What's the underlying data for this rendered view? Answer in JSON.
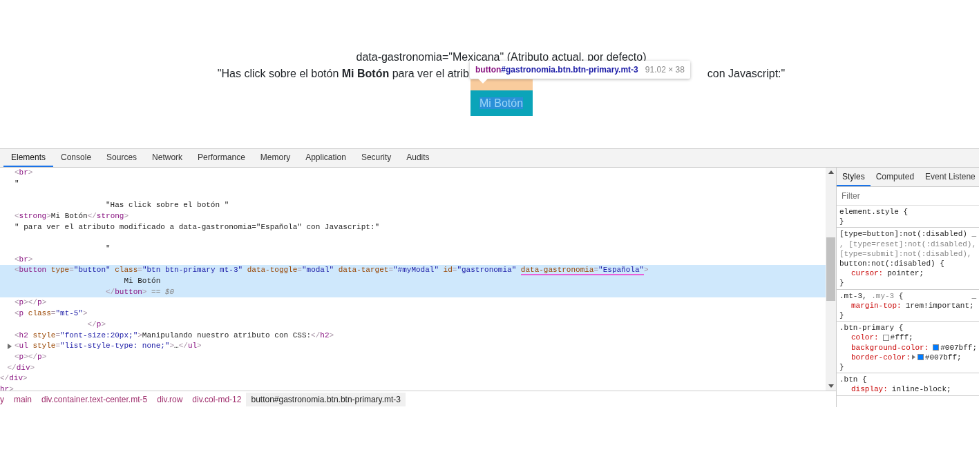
{
  "page": {
    "lines": [
      {
        "segments": [
          "data-gastronomia=\"Mexicana\" (Atributo actual, por defecto)"
        ]
      },
      {
        "segments": [
          "\"Has click sobre el botón **Mi Botón** para ver el atrib",
          "con Javascript:\""
        ]
      }
    ],
    "button": {
      "label": "Mi Botón",
      "inspected": true
    }
  },
  "tooltip": {
    "tag": "button",
    "selector": "#gastronomia.btn.btn-primary.mt-3",
    "size": "91.02 × 38"
  },
  "devtools": {
    "tabs": [
      {
        "label": "Elements",
        "selected": true
      },
      {
        "label": "Console",
        "selected": false
      },
      {
        "label": "Sources",
        "selected": false
      },
      {
        "label": "Network",
        "selected": false
      },
      {
        "label": "Performance",
        "selected": false
      },
      {
        "label": "Memory",
        "selected": false
      },
      {
        "label": "Application",
        "selected": false
      },
      {
        "label": "Security",
        "selected": false
      },
      {
        "label": "Audits",
        "selected": false
      }
    ],
    "dom_tree": [
      {
        "selected": false,
        "closing": [
          {
            "kind": "punct",
            "text": "</"
          },
          {
            "kind": "tag",
            "text": "div"
          },
          {
            "kind": "punct",
            "text": ">"
          }
        ],
        "children": [
          {
            "selected": false,
            "closing": [
              {
                "kind": "punct",
                "text": "</"
              },
              {
                "kind": "tag",
                "text": "div"
              },
              {
                "kind": "punct",
                "text": ">"
              }
            ],
            "children": [
              {
                "selected": false,
                "lines": [
                  {
                    "tokens": [
                      {
                        "kind": "punct",
                        "text": "<"
                      },
                      {
                        "kind": "tag",
                        "text": "br"
                      },
                      {
                        "kind": "punct",
                        "text": ">"
                      }
                    ]
                  }
                ]
              },
              {
                "selected": false,
                "lines": [
                  {
                    "tokens": [
                      {
                        "kind": "text",
                        "text": "\"\n\n                    \"Has click sobre el botón \""
                      }
                    ]
                  }
                ]
              },
              {
                "selected": false,
                "lines": [
                  {
                    "tokens": [
                      {
                        "kind": "punct",
                        "text": "<"
                      },
                      {
                        "kind": "tag",
                        "text": "strong"
                      },
                      {
                        "kind": "punct",
                        "text": ">"
                      },
                      {
                        "kind": "text",
                        "text": "Mi Botón"
                      },
                      {
                        "kind": "punct",
                        "text": "</"
                      },
                      {
                        "kind": "tag",
                        "text": "strong"
                      },
                      {
                        "kind": "punct",
                        "text": ">"
                      }
                    ]
                  }
                ]
              },
              {
                "selected": false,
                "lines": [
                  {
                    "tokens": [
                      {
                        "kind": "text",
                        "text": "\" para ver el atributo modificado a data-gastronomia=\"Española\" con Javascript:\"\n\n                    \""
                      }
                    ]
                  }
                ]
              },
              {
                "selected": false,
                "lines": [
                  {
                    "tokens": [
                      {
                        "kind": "punct",
                        "text": "<"
                      },
                      {
                        "kind": "tag",
                        "text": "br"
                      },
                      {
                        "kind": "punct",
                        "text": ">"
                      }
                    ]
                  }
                ]
              },
              {
                "selected": true,
                "lines": [
                  {
                    "tokens": [
                      {
                        "kind": "punct",
                        "text": "<"
                      },
                      {
                        "kind": "tag",
                        "text": "button"
                      },
                      {
                        "kind": "attr",
                        "text": " type"
                      },
                      {
                        "kind": "punct",
                        "text": "="
                      },
                      {
                        "kind": "value",
                        "text": "\"button\""
                      },
                      {
                        "kind": "attr",
                        "text": " class"
                      },
                      {
                        "kind": "punct",
                        "text": "="
                      },
                      {
                        "kind": "value",
                        "text": "\"btn btn-primary mt-3\""
                      },
                      {
                        "kind": "attr",
                        "text": " data-toggle"
                      },
                      {
                        "kind": "punct",
                        "text": "="
                      },
                      {
                        "kind": "value",
                        "text": "\"modal\""
                      },
                      {
                        "kind": "attr",
                        "text": " data-target"
                      },
                      {
                        "kind": "punct",
                        "text": "="
                      },
                      {
                        "kind": "value",
                        "text": "\"#myModal\""
                      },
                      {
                        "kind": "attr",
                        "text": " id"
                      },
                      {
                        "kind": "punct",
                        "text": "="
                      },
                      {
                        "kind": "value",
                        "text": "\"gastronomia\" "
                      },
                      {
                        "kind": "underlined",
                        "tokens": [
                          {
                            "kind": "attr",
                            "text": "data-gastronomia"
                          },
                          {
                            "kind": "punct",
                            "text": "="
                          },
                          {
                            "kind": "value",
                            "text": "\"Española\""
                          }
                        ]
                      },
                      {
                        "kind": "punct",
                        "text": ">"
                      }
                    ]
                  },
                  {
                    "tokens": [
                      {
                        "kind": "text",
                        "text": "                        Mi Botón"
                      }
                    ]
                  },
                  {
                    "tokens": [
                      {
                        "kind": "punct",
                        "text": "                    </"
                      },
                      {
                        "kind": "tag",
                        "text": "button"
                      },
                      {
                        "kind": "punct",
                        "text": ">"
                      },
                      {
                        "kind": "note",
                        "text": " == $0"
                      }
                    ]
                  }
                ]
              },
              {
                "selected": false,
                "lines": [
                  {
                    "tokens": [
                      {
                        "kind": "punct",
                        "text": "<"
                      },
                      {
                        "kind": "tag",
                        "text": "p"
                      },
                      {
                        "kind": "punct",
                        "text": ">"
                      },
                      {
                        "kind": "punct",
                        "text": "</"
                      },
                      {
                        "kind": "tag",
                        "text": "p"
                      },
                      {
                        "kind": "punct",
                        "text": ">"
                      }
                    ]
                  }
                ]
              },
              {
                "selected": false,
                "lines": [
                  {
                    "tokens": [
                      {
                        "kind": "punct",
                        "text": "<"
                      },
                      {
                        "kind": "tag",
                        "text": "p"
                      },
                      {
                        "kind": "attr",
                        "text": " class"
                      },
                      {
                        "kind": "punct",
                        "text": "="
                      },
                      {
                        "kind": "value",
                        "text": "\"mt-5\""
                      },
                      {
                        "kind": "punct",
                        "text": ">"
                      }
                    ]
                  },
                  {
                    "tokens": [
                      {
                        "kind": "punct",
                        "text": "                </"
                      },
                      {
                        "kind": "tag",
                        "text": "p"
                      },
                      {
                        "kind": "punct",
                        "text": ">"
                      }
                    ]
                  }
                ]
              },
              {
                "selected": false,
                "lines": [
                  {
                    "tokens": [
                      {
                        "kind": "punct",
                        "text": "<"
                      },
                      {
                        "kind": "tag",
                        "text": "h2"
                      },
                      {
                        "kind": "attr",
                        "text": " style"
                      },
                      {
                        "kind": "punct",
                        "text": "="
                      },
                      {
                        "kind": "value",
                        "text": "\"font-size:20px;\""
                      },
                      {
                        "kind": "punct",
                        "text": ">"
                      },
                      {
                        "kind": "text",
                        "text": "Manipulando nuestro atributo con CSS:"
                      },
                      {
                        "kind": "punct",
                        "text": "</"
                      },
                      {
                        "kind": "tag",
                        "text": "h2"
                      },
                      {
                        "kind": "punct",
                        "text": ">"
                      }
                    ]
                  }
                ]
              },
              {
                "selected": false,
                "expanded": false,
                "lines": [
                  {
                    "tokens": [
                      {
                        "kind": "punct",
                        "text": "<"
                      },
                      {
                        "kind": "tag",
                        "text": "ul"
                      },
                      {
                        "kind": "attr",
                        "text": " style"
                      },
                      {
                        "kind": "punct",
                        "text": "="
                      },
                      {
                        "kind": "value",
                        "text": "\"list-style-type: none;\""
                      },
                      {
                        "kind": "punct",
                        "text": ">"
                      },
                      {
                        "kind": "text",
                        "text": "…"
                      },
                      {
                        "kind": "punct",
                        "text": "</"
                      },
                      {
                        "kind": "tag",
                        "text": "ul"
                      },
                      {
                        "kind": "punct",
                        "text": ">"
                      }
                    ]
                  }
                ]
              },
              {
                "selected": false,
                "lines": [
                  {
                    "tokens": [
                      {
                        "kind": "punct",
                        "text": "<"
                      },
                      {
                        "kind": "tag",
                        "text": "p"
                      },
                      {
                        "kind": "punct",
                        "text": ">"
                      },
                      {
                        "kind": "punct",
                        "text": "</"
                      },
                      {
                        "kind": "tag",
                        "text": "p"
                      },
                      {
                        "kind": "punct",
                        "text": ">"
                      }
                    ]
                  }
                ]
              }
            ]
          }
        ]
      },
      {
        "selected": false,
        "lines": [
          {
            "tokens": [
              {
                "kind": "tag",
                "text": "hr"
              },
              {
                "kind": "punct",
                "text": ">"
              }
            ]
          }
        ]
      }
    ],
    "breadcrumbs": [
      {
        "label": "y",
        "selected": false
      },
      {
        "label": "main",
        "selected": false
      },
      {
        "label": "div.container.text-center.mt-5",
        "selected": false
      },
      {
        "label": "div.row",
        "selected": false
      },
      {
        "label": "div.col-md-12",
        "selected": false
      },
      {
        "label": "button#gastronomia.btn.btn-primary.mt-3",
        "selected": true
      }
    ],
    "styles_tabs": [
      {
        "label": "Styles",
        "selected": true
      },
      {
        "label": "Computed",
        "selected": false
      },
      {
        "label": "Event Listene",
        "selected": false
      }
    ],
    "filter": {
      "placeholder": "Filter"
    },
    "rules": [
      {
        "selector_lines": [
          [
            {
              "text": "element.style {",
              "matched": true
            }
          ]
        ],
        "closing": "}"
      },
      {
        "selector_lines": [
          [
            {
              "text": "[type=button]:not(:disabled)",
              "matched": true
            }
          ],
          [
            {
              "text": ", [type=reset]:not(:disabled),",
              "matched": false
            }
          ],
          [
            {
              "text": "[type=submit]:not(:disabled),",
              "matched": false
            }
          ],
          [
            {
              "text": "button:not(:disabled) {",
              "matched": true
            }
          ]
        ],
        "source": "_",
        "declarations": [
          {
            "property": "cursor:",
            "value": "pointer;",
            "expandable": false
          }
        ],
        "closing": "}"
      },
      {
        "selector_lines": [
          [
            {
              "text": ".mt-3,",
              "matched": true
            },
            {
              "text": " .my-3",
              "matched": false
            },
            {
              "text": " {",
              "matched": true
            }
          ]
        ],
        "source": "_",
        "declarations": [
          {
            "property": "margin-top:",
            "value": "1rem!important;",
            "expandable": false
          }
        ],
        "closing": "}"
      },
      {
        "selector_lines": [
          [
            {
              "text": ".btn-primary {",
              "matched": true
            }
          ]
        ],
        "declarations": [
          {
            "property": "color:",
            "value": "#fff;",
            "color": "#ffffff",
            "expandable": false
          },
          {
            "property": "background-color:",
            "value": "#007bff;",
            "color": "#007bff",
            "expandable": false
          },
          {
            "property": "border-color:",
            "value": "#007bff;",
            "color": "#007bff",
            "expandable": true
          }
        ],
        "closing": "}"
      },
      {
        "selector_lines": [
          [
            {
              "text": ".btn {",
              "matched": true
            }
          ]
        ],
        "declarations": [
          {
            "property": "display:",
            "value": "inline-block;",
            "expandable": false
          }
        ]
      }
    ]
  }
}
